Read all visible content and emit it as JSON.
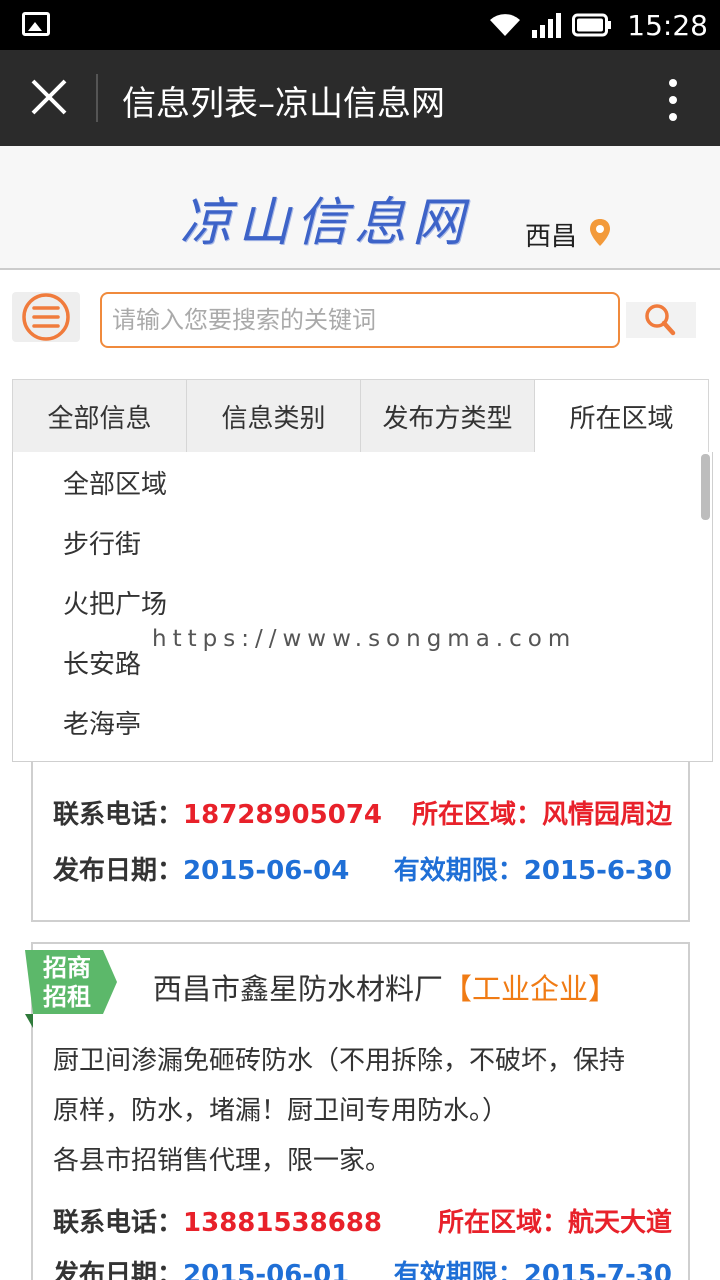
{
  "status_bar": {
    "time": "15:28"
  },
  "app_bar": {
    "title": "信息列表–凉山信息网"
  },
  "header": {
    "logo": "凉山信息网",
    "city": "西昌"
  },
  "search": {
    "placeholder": "请输入您要搜索的关键词"
  },
  "filters": {
    "tabs": [
      "全部信息",
      "信息类别",
      "发布方类型",
      "所在区域"
    ],
    "active_index": 3
  },
  "dropdown": {
    "items": [
      "全部区域",
      "步行街",
      "火把广场",
      "长安路",
      "老海亭"
    ]
  },
  "watermark": "https://www.songma.com",
  "colors": {
    "accent": "#f08a3c",
    "phone": "#e8212a",
    "date": "#1f6fd6",
    "ribbon": "#5cb86a"
  },
  "listings": [
    {
      "phone_label": "联系电话：",
      "phone": "18728905074",
      "region_label": "所在区域：",
      "region": "风情园周边",
      "date_label": "发布日期：",
      "date": "2015-06-04",
      "expiry_label": "有效期限：",
      "expiry": "2015-6-30"
    },
    {
      "ribbon": "招商招租",
      "title": "西昌市鑫星防水材料厂",
      "category": "【工业企业】",
      "desc_lines": [
        "厨卫间渗漏免砸砖防水（不用拆除，不破坏，保持",
        "原样，防水，堵漏！厨卫间专用防水。）",
        "各县市招销售代理，限一家。"
      ],
      "phone_label": "联系电话：",
      "phone": "13881538688",
      "region_label": "所在区域：",
      "region": "航天大道",
      "date_label": "发布日期：",
      "date": "2015-06-01",
      "expiry_label": "有效期限：",
      "expiry": "2015-7-30"
    }
  ]
}
